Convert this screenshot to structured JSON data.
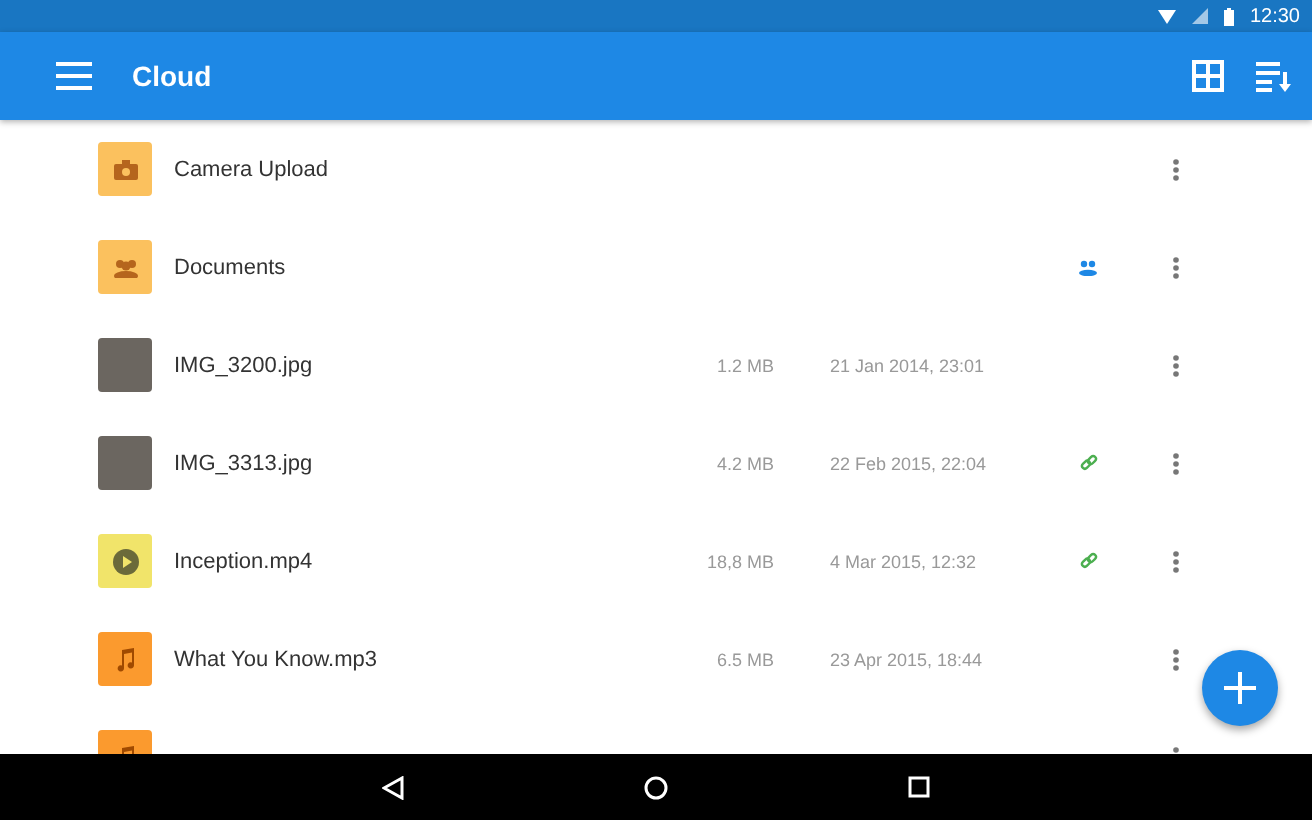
{
  "status_bar": {
    "time": "12:30"
  },
  "app_bar": {
    "title": "Cloud"
  },
  "files": [
    {
      "kind": "camera-folder",
      "name": "Camera Upload",
      "shared": false,
      "linked": false
    },
    {
      "kind": "shared-folder",
      "name": "Documents",
      "shared": true,
      "linked": false
    },
    {
      "kind": "image",
      "name": "IMG_3200.jpg",
      "size": "1.2 MB",
      "date": "21 Jan 2014, 23:01",
      "shared": false,
      "linked": false
    },
    {
      "kind": "image",
      "name": "IMG_3313.jpg",
      "size": "4.2 MB",
      "date": "22 Feb 2015, 22:04",
      "shared": false,
      "linked": true
    },
    {
      "kind": "video",
      "name": "Inception.mp4",
      "size": "18,8 MB",
      "date": "4 Mar 2015, 12:32",
      "shared": false,
      "linked": true
    },
    {
      "kind": "audio",
      "name": "What You Know.mp3",
      "size": "6.5 MB",
      "date": "23 Apr 2015, 18:44",
      "shared": false,
      "linked": false
    },
    {
      "kind": "audio",
      "shared": false,
      "linked": false
    }
  ]
}
